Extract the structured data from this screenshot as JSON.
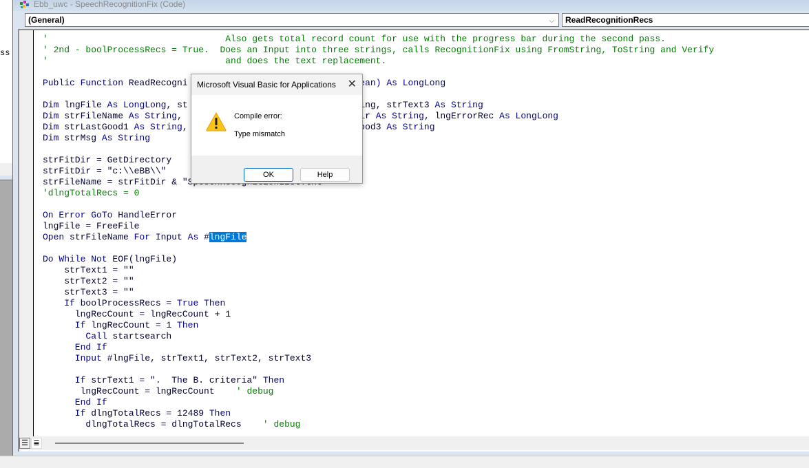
{
  "background_window": {
    "partial_text": "ss"
  },
  "window": {
    "title": "Ebb_uwc - SpeechRecognitionFix (Code)",
    "object_combo": "(General)",
    "procedure_combo": "ReadRecognitionRecs"
  },
  "code_lines": [
    [
      {
        "t": "'                                 Also gets total record count for use with the progress bar during the second pass.",
        "c": "cm"
      }
    ],
    [
      {
        "t": "' 2nd - boolProcessRecs = True.  Does an Input into three strings, calls RecognitionFix using FromString, ToString and Verify",
        "c": "cm"
      }
    ],
    [
      {
        "t": "'                                 and does the text replacement.",
        "c": "cm"
      }
    ],
    [],
    [
      {
        "t": "Public Function ",
        "c": "kw"
      },
      {
        "t": "ReadRecogni"
      },
      {
        "t": "                               "
      },
      {
        "t": "lean) ",
        "c": "kw"
      },
      {
        "t": "As LongLong",
        "c": "kw"
      }
    ],
    [],
    [
      {
        "t": "Dim ",
        "c": "kw"
      },
      {
        "t": "lngFile "
      },
      {
        "t": "As LongLong",
        "c": "kw"
      },
      {
        "t": ", st                              tring, strText3 "
      },
      {
        "t": "As String",
        "c": "kw"
      }
    ],
    [
      {
        "t": "Dim ",
        "c": "kw"
      },
      {
        "t": "strFileName "
      },
      {
        "t": "As String",
        "c": "kw"
      },
      {
        "t": ",                                Dir "
      },
      {
        "t": "As String",
        "c": "kw"
      },
      {
        "t": ", lngErrorRec "
      },
      {
        "t": "As LongLong",
        "c": "kw"
      }
    ],
    [
      {
        "t": "Dim ",
        "c": "kw"
      },
      {
        "t": "strLastGood1 "
      },
      {
        "t": "As String",
        "c": "kw"
      },
      {
        "t": ",                              tGood3 "
      },
      {
        "t": "As String",
        "c": "kw"
      }
    ],
    [
      {
        "t": "Dim ",
        "c": "kw"
      },
      {
        "t": "strMsg "
      },
      {
        "t": "As String",
        "c": "kw"
      }
    ],
    [],
    [
      {
        "t": "strFitDir = GetDirectory"
      }
    ],
    [
      {
        "t": "strFitDir = \"c:\\\\eBB\\\\\""
      }
    ],
    [
      {
        "t": "strFileName = strFitDir & \"SpeechRecognitionList.txt\""
      }
    ],
    [
      {
        "t": "'dlngTotalRecs = 0",
        "c": "cm"
      }
    ],
    [],
    [
      {
        "t": "On Error GoTo ",
        "c": "kw"
      },
      {
        "t": "HandleError"
      }
    ],
    [
      {
        "t": "lngFile = FreeFile"
      }
    ],
    [
      {
        "t": "Open ",
        "c": "kw"
      },
      {
        "t": "strFileName "
      },
      {
        "t": "For Input As ",
        "c": "kw"
      },
      {
        "t": "#"
      },
      {
        "t": "lngFile",
        "c": "sel"
      }
    ],
    [],
    [
      {
        "t": "Do While Not ",
        "c": "kw"
      },
      {
        "t": "EOF(lngFile)"
      }
    ],
    [
      {
        "t": "    strText1 = \"\""
      }
    ],
    [
      {
        "t": "    strText2 = \"\""
      }
    ],
    [
      {
        "t": "    strText3 = \"\""
      }
    ],
    [
      {
        "t": "    If ",
        "c": "kw"
      },
      {
        "t": "boolProcessRecs = "
      },
      {
        "t": "True Then",
        "c": "kw"
      }
    ],
    [
      {
        "t": "      lngRecCount = lngRecCount + 1"
      }
    ],
    [
      {
        "t": "      If ",
        "c": "kw"
      },
      {
        "t": "lngRecCount = 1 "
      },
      {
        "t": "Then",
        "c": "kw"
      }
    ],
    [
      {
        "t": "        Call ",
        "c": "kw"
      },
      {
        "t": "startsearch"
      }
    ],
    [
      {
        "t": "      End If",
        "c": "kw"
      }
    ],
    [
      {
        "t": "      Input ",
        "c": "kw"
      },
      {
        "t": "#lngFile, strText1, strText2, strText3"
      }
    ],
    [],
    [
      {
        "t": "      If ",
        "c": "kw"
      },
      {
        "t": "strText1 = \".  The B. criteria\" "
      },
      {
        "t": "Then",
        "c": "kw"
      }
    ],
    [
      {
        "t": "       lngRecCount = lngRecCount    "
      },
      {
        "t": "' debug",
        "c": "cm"
      }
    ],
    [
      {
        "t": "      End If",
        "c": "kw"
      }
    ],
    [
      {
        "t": "      If ",
        "c": "kw"
      },
      {
        "t": "dlngTotalRecs = 12489 "
      },
      {
        "t": "Then",
        "c": "kw"
      }
    ],
    [
      {
        "t": "        dlngTotalRecs = dlngTotalRecs    "
      },
      {
        "t": "' debug",
        "c": "cm"
      }
    ]
  ],
  "dialog": {
    "title": "Microsoft Visual Basic for Applications",
    "close_label": "✕",
    "line1": "Compile error:",
    "line2": "Type mismatch",
    "ok_label": "OK",
    "help_label": "Help",
    "icon": "warning-icon"
  },
  "icons": {
    "dropdown": "⌵",
    "view_procedure": "☰",
    "view_module": "≣"
  }
}
